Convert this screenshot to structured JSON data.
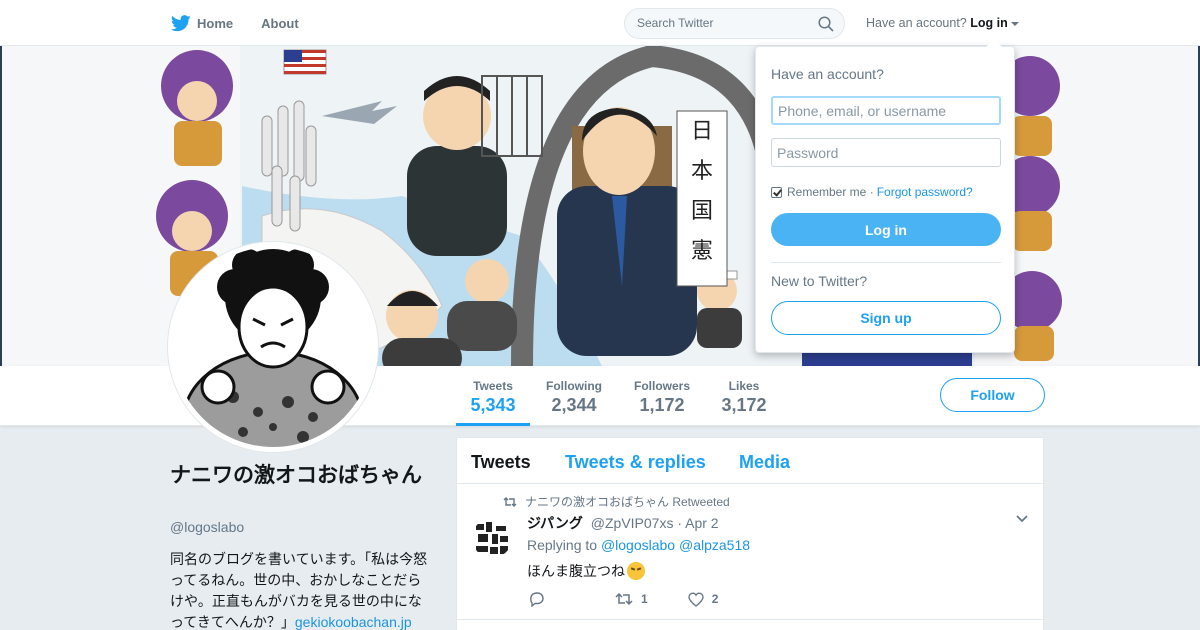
{
  "nav": {
    "home_label": "Home",
    "about_label": "About",
    "search_placeholder": "Search Twitter",
    "have_account_text": "Have an account?",
    "login_label": "Log in"
  },
  "stats": {
    "tweets_label": "Tweets",
    "tweets_value": "5,343",
    "following_label": "Following",
    "following_value": "2,344",
    "followers_label": "Followers",
    "followers_value": "1,172",
    "likes_label": "Likes",
    "likes_value": "3,172",
    "follow_button": "Follow"
  },
  "profile": {
    "name": "ナニワの激オコおばちゃん",
    "handle": "@logoslabo",
    "bio": "同名のブログを書いています。「私は今怒ってるねん。世の中、おかしなことだらけや。正直もんがバカを見る世の中になってきてへんか？」",
    "bio_link": "gekiokoobachan.jp"
  },
  "timeline": {
    "tabs": [
      "Tweets",
      "Tweets & replies",
      "Media"
    ],
    "tweet": {
      "retweeted_by": "ナニワの激オコおばちゃん Retweeted",
      "fullname": "ジパング",
      "username": "@ZpVIP07xs",
      "date": "· Apr 2",
      "replying_to_prefix": "Replying to",
      "mention_1": "@logoslabo",
      "mention_2": "@alpza518",
      "text": "ほんま腹立つね",
      "retweet_count": "1",
      "like_count": "2"
    }
  },
  "banner": {
    "scroll_text": "日本国憲法"
  },
  "login_dropdown": {
    "title": "Have an account?",
    "username_placeholder": "Phone, email, or username",
    "password_placeholder": "Password",
    "remember_me": "Remember me ·",
    "forgot_password": "Forgot password?",
    "login_button": "Log in",
    "new_to_twitter": "New to Twitter?",
    "signup_button": "Sign up"
  },
  "colors": {
    "accent": "#1da1f2",
    "login_button": "#4ab3f4",
    "background": "#e6ecf0"
  }
}
